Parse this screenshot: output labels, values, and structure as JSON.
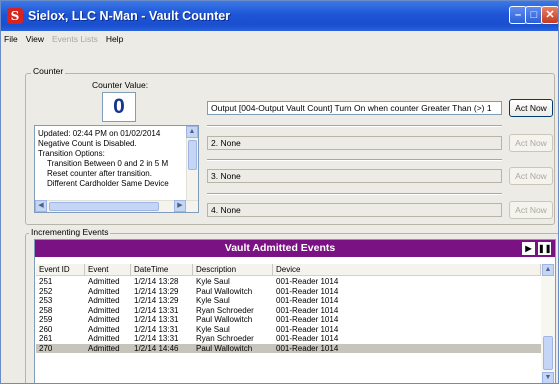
{
  "window": {
    "title": "Sielox, LLC N-Man - Vault Counter",
    "icon": "sielox-s-icon"
  },
  "menu": [
    {
      "label": "File",
      "enabled": true
    },
    {
      "label": "View",
      "enabled": true
    },
    {
      "label": "Events Lists",
      "enabled": false
    },
    {
      "label": "Help",
      "enabled": true
    }
  ],
  "counter": {
    "group_label": "Counter",
    "value_label": "Counter Value:",
    "value": "0",
    "status_lines": [
      "Updated: 02:44 PM on 01/02/2014",
      "Negative Count is Disabled.",
      "Transition Options:",
      "  Transition Between 0 and 2 in 5 M",
      "  Reset counter after transition.",
      "  Different Cardholder Same Device"
    ],
    "actions": [
      {
        "text": "Output [004-Output Vault Count] Turn On when counter Greater Than (>) 1",
        "button": "Act Now",
        "enabled": true
      },
      {
        "text": "2.  None",
        "button": "Act Now",
        "enabled": false
      },
      {
        "text": "3.  None",
        "button": "Act Now",
        "enabled": false
      },
      {
        "text": "4.  None",
        "button": "Act Now",
        "enabled": false
      }
    ]
  },
  "incrementing": {
    "group_label": "Incrementing Events",
    "list_title": "Vault Admitted Events",
    "columns": [
      "Event ID",
      "Event",
      "DateTime",
      "Description",
      "Device"
    ],
    "rows": [
      [
        "251",
        "Admitted",
        "1/2/14 13:28",
        "Kyle Saul",
        "001-Reader 1014"
      ],
      [
        "252",
        "Admitted",
        "1/2/14 13:29",
        "Paul Wallowitch",
        "001-Reader 1014"
      ],
      [
        "253",
        "Admitted",
        "1/2/14 13:29",
        "Kyle Saul",
        "001-Reader 1014"
      ],
      [
        "258",
        "Admitted",
        "1/2/14 13:31",
        "Ryan Schroeder",
        "001-Reader 1014"
      ],
      [
        "259",
        "Admitted",
        "1/2/14 13:31",
        "Paul Wallowitch",
        "001-Reader 1014"
      ],
      [
        "260",
        "Admitted",
        "1/2/14 13:31",
        "Kyle Saul",
        "001-Reader 1014"
      ],
      [
        "261",
        "Admitted",
        "1/2/14 13:31",
        "Ryan Schroeder",
        "001-Reader 1014"
      ],
      [
        "270",
        "Admitted",
        "1/2/14 14:46",
        "Paul Wallowitch",
        "001-Reader 1014"
      ]
    ],
    "selected_row": 7,
    "header_color": "#7b1283"
  }
}
